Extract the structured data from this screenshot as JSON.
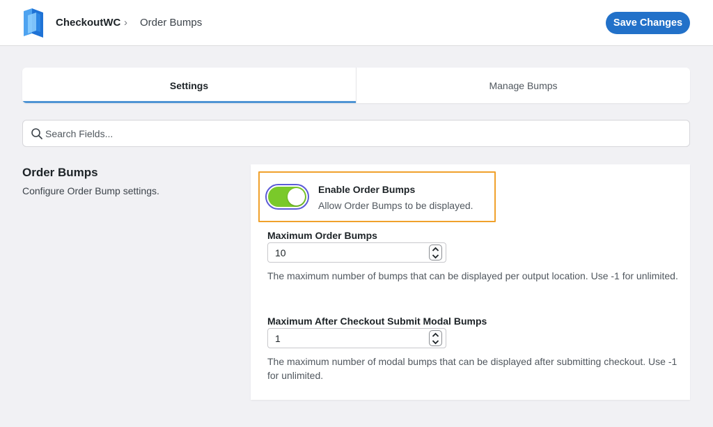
{
  "header": {
    "brand": "CheckoutWC",
    "breadcrumb_separator": "›",
    "breadcrumb_current": "Order Bumps",
    "save_label": "Save Changes",
    "logo_icon": "checkoutwc-logo-icon",
    "accent_color": "#2271c9"
  },
  "tabs": [
    {
      "label": "Settings",
      "active": true
    },
    {
      "label": "Manage Bumps",
      "active": false
    }
  ],
  "search": {
    "placeholder": "Search Fields...",
    "icon": "search-icon"
  },
  "section": {
    "title": "Order Bumps",
    "description": "Configure Order Bump settings."
  },
  "enable_toggle": {
    "label": "Enable Order Bumps",
    "description": "Allow Order Bumps to be displayed.",
    "enabled": true,
    "on_color": "#7ac92a",
    "highlight_color": "#f0a12b"
  },
  "fields": [
    {
      "label": "Maximum Order Bumps",
      "value": "10",
      "help": "The maximum number of bumps that can be displayed per output location. Use -1 for unlimited."
    },
    {
      "label": "Maximum After Checkout Submit Modal Bumps",
      "value": "1",
      "help": "The maximum number of modal bumps that can be displayed after submitting checkout. Use -1 for unlimited."
    }
  ]
}
